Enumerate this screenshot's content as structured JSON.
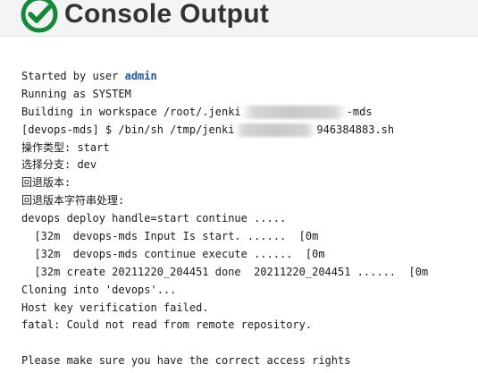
{
  "header": {
    "title": "Console Output",
    "status_icon": "check-circle-icon",
    "status_color": "#138a36"
  },
  "console": {
    "started_prefix": "Started by user ",
    "user": "admin",
    "lines": [
      "Running as SYSTEM",
      "Building in workspace /root/.jenki",
      "[devops-mds] $ /bin/sh /tmp/jenki",
      "操作类型: start",
      "选择分支: dev",
      "回退版本:",
      "回退版本字符串处理:",
      "devops deploy handle=start continue .....",
      "  [32m  devops-mds Input Is start. ......  [0m",
      "  [32m  devops-mds continue execute ......  [0m",
      "  [32m create 20211220_204451 done  20211220_204451 ......  [0m",
      "Cloning into 'devops'...",
      "Host key verification failed.",
      "fatal: Could not read from remote repository.",
      "",
      "Please make sure you have the correct access rights"
    ],
    "workspace_suffix": "-mds",
    "script_suffix": "946384883.sh"
  }
}
